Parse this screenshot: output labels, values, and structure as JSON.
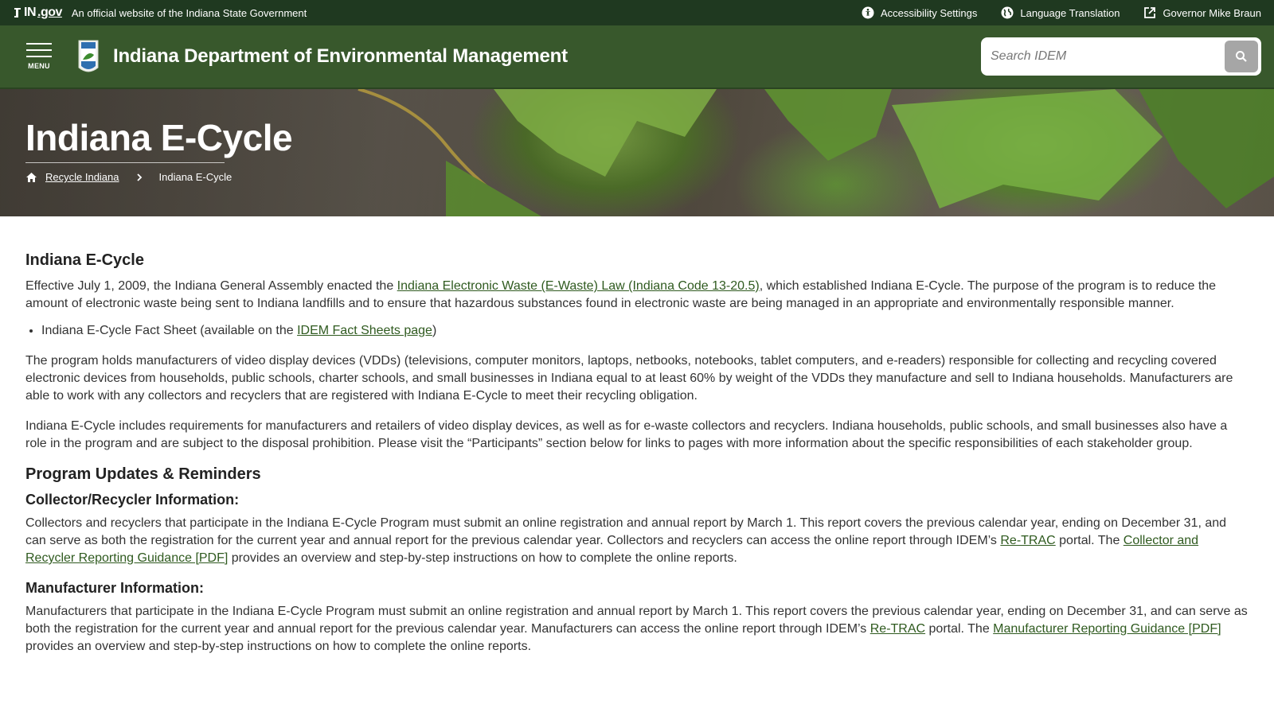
{
  "utility": {
    "logo_in": "IN",
    "logo_gov": ".gov",
    "official_text": "An official website of the Indiana State Government",
    "links": {
      "accessibility": "Accessibility Settings",
      "translation": "Language Translation",
      "governor": "Governor Mike Braun"
    }
  },
  "header": {
    "menu_label": "MENU",
    "agency_title": "Indiana Department of Environmental Management",
    "search_placeholder": "Search IDEM"
  },
  "hero": {
    "title": "Indiana E-Cycle",
    "breadcrumb": {
      "parent": "Recycle Indiana",
      "current": "Indiana E-Cycle"
    }
  },
  "content": {
    "heading": "Indiana E-Cycle",
    "intro": {
      "before": "Effective July 1, 2009, the Indiana General Assembly enacted the ",
      "link": "Indiana Electronic Waste (E-Waste) Law (Indiana Code 13-20.5)",
      "after": ", which established Indiana E-Cycle. The purpose of the program is to reduce the amount of electronic waste being sent to Indiana landfills and to ensure that hazardous substances found in electronic waste are being managed in an appropriate and environmentally responsible manner."
    },
    "bullet": {
      "before": "Indiana E-Cycle Fact Sheet (available on the ",
      "link": "IDEM Fact Sheets page",
      "after": ")"
    },
    "para_program": "The program holds manufacturers of video display devices (VDDs) (televisions, computer monitors, laptops, netbooks, notebooks, tablet computers, and e-readers) responsible for collecting and recycling covered electronic devices from households, public schools, charter schools, and small businesses in Indiana equal to at least 60% by weight of the VDDs they manufacture and sell to Indiana households. Manufacturers are able to work with any collectors and recyclers that are registered with Indiana E-Cycle to meet their recycling obligation.",
    "para_requirements": "Indiana E-Cycle includes requirements for manufacturers and retailers of video display devices, as well as for e-waste collectors and recyclers. Indiana households, public schools, and small businesses also have a role in the program and are subject to the disposal prohibition. Please visit the “Participants” section below for links to pages with more information about the specific responsibilities of each stakeholder group.",
    "updates_heading": "Program Updates & Reminders",
    "collector": {
      "heading": "Collector/Recycler Information:",
      "before": "Collectors and recyclers that participate in the Indiana E-Cycle Program must submit an online registration and annual report by March 1. This report covers the previous calendar year, ending on December 31, and can serve as both the registration for the current year and annual report for the previous calendar year. Collectors and recyclers can access the online report through IDEM’s ",
      "link1": "Re-TRAC",
      "middle": " portal. The ",
      "link2": "Collector and Recycler Reporting Guidance [PDF]",
      "after": " provides an overview and step-by-step instructions on how to complete the online reports."
    },
    "manufacturer": {
      "heading": "Manufacturer Information:",
      "before": "Manufacturers that participate in the Indiana E-Cycle Program must submit an online registration and annual report by March 1. This report covers the previous calendar year, ending on December 31, and can serve as both the registration for the current year and annual report for the previous calendar year. Manufacturers can access the online report through IDEM’s ",
      "link1": "Re-TRAC",
      "middle": " portal. The ",
      "link2": "Manufacturer Reporting Guidance [PDF]",
      "after": " provides an overview and step-by-step instructions on how to complete the online reports."
    }
  },
  "colors": {
    "utility_bg": "#1f3920",
    "header_bg": "#38582c",
    "link": "#2f5a1f"
  }
}
